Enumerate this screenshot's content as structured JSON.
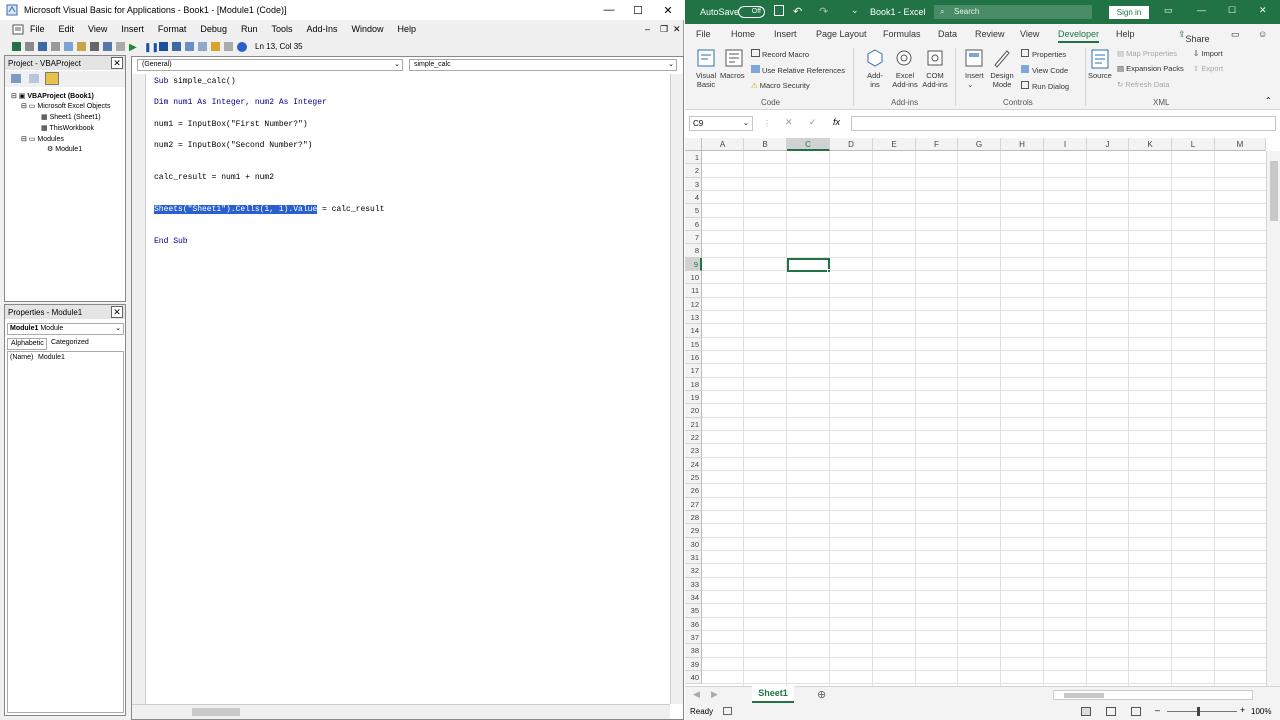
{
  "vba": {
    "title": "Microsoft Visual Basic for Applications - Book1 - [Module1 (Code)]",
    "menu": [
      "File",
      "Edit",
      "View",
      "Insert",
      "Format",
      "Debug",
      "Run",
      "Tools",
      "Add-Ins",
      "Window",
      "Help"
    ],
    "cursor_pos": "Ln 13, Col 35",
    "project_title": "Project - VBAProject",
    "tree": [
      "VBAProject (Book1)",
      "Microsoft Excel Objects",
      "Sheet1 (Sheet1)",
      "ThisWorkbook",
      "Modules",
      "Module1"
    ],
    "props_title": "Properties - Module1",
    "props_object": "Module1",
    "props_object_type": "Module",
    "props_tabs": [
      "Alphabetic",
      "Categorized"
    ],
    "props_name_key": "(Name)",
    "props_name_val": "Module1",
    "combo_object": "(General)",
    "combo_proc": "simple_calc",
    "code": {
      "l1_kw": "Sub",
      "l1_rest": " simple_calc()",
      "l2": "Dim num1 As Integer, num2 As Integer",
      "l3": "num1 = InputBox(\"First Number?\")",
      "l4": "num2 = InputBox(\"Second Number?\")",
      "l5": "calc_result = num1 + num2",
      "l6_sel": "Sheets(\"Sheet1\").Cells(1, 1).Value",
      "l6_rest": " = calc_result",
      "l7": "End Sub"
    }
  },
  "excel": {
    "autosave": "AutoSave",
    "autosave_state": "Off",
    "title": "Book1 - Excel",
    "search_placeholder": "Search",
    "signin": "Sign in",
    "tabs": [
      "File",
      "Home",
      "Insert",
      "Page Layout",
      "Formulas",
      "Data",
      "Review",
      "View",
      "Developer",
      "Help"
    ],
    "active_tab": "Developer",
    "share": "Share",
    "ribbon": {
      "visual_basic": "Visual Basic",
      "macros": "Macros",
      "record_macro": "Record Macro",
      "use_relative": "Use Relative References",
      "macro_security": "Macro Security",
      "group_code": "Code",
      "add_ins": "Add-ins",
      "excel_add_ins": "Excel Add-ins",
      "com_add_ins": "COM Add-ins",
      "group_addins": "Add-ins",
      "insert": "Insert",
      "design_mode": "Design Mode",
      "properties": "Properties",
      "view_code": "View Code",
      "run_dialog": "Run Dialog",
      "group_controls": "Controls",
      "source": "Source",
      "map_properties": "Map Properties",
      "expansion_packs": "Expansion Packs",
      "refresh_data": "Refresh Data",
      "import": "Import",
      "export": "Export",
      "group_xml": "XML"
    },
    "name_box": "C9",
    "columns": [
      "A",
      "B",
      "C",
      "D",
      "E",
      "F",
      "G",
      "H",
      "I",
      "J",
      "K",
      "L",
      "M"
    ],
    "rows": [
      "1",
      "2",
      "3",
      "4",
      "5",
      "6",
      "7",
      "8",
      "9",
      "10",
      "11",
      "12",
      "13",
      "14",
      "15",
      "16",
      "17",
      "18",
      "19",
      "20",
      "21",
      "22",
      "23",
      "24",
      "25",
      "26",
      "27",
      "28",
      "29",
      "30",
      "31",
      "32",
      "33",
      "34",
      "35",
      "36",
      "37",
      "38",
      "39",
      "40"
    ],
    "sheet_tab": "Sheet1",
    "status": "Ready",
    "zoom": "100%",
    "colors": {
      "excel_green": "#217346",
      "selection_blue": "#2a5fcf",
      "keyword": "#00008b"
    }
  }
}
